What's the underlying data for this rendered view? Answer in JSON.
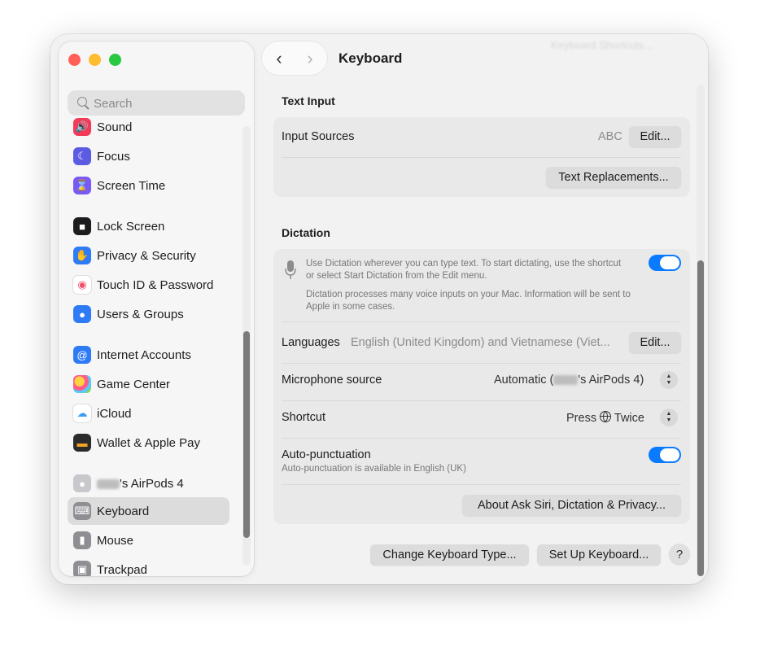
{
  "window": {
    "title": "Keyboard",
    "ghost_button": "Keyboard Shortcuts..."
  },
  "search": {
    "placeholder": "Search"
  },
  "sidebar": {
    "items": [
      {
        "label": "Sound",
        "icon": "speaker-icon",
        "color": "#f23b58"
      },
      {
        "label": "Focus",
        "icon": "moon-icon",
        "color": "#5b5ce2"
      },
      {
        "label": "Screen Time",
        "icon": "hourglass-icon",
        "color": "#7a5af5"
      },
      {
        "label": "Lock Screen",
        "icon": "lock-icon",
        "color": "#1c1c1e"
      },
      {
        "label": "Privacy & Security",
        "icon": "hand-icon",
        "color": "#2f7bf6"
      },
      {
        "label": "Touch ID & Password",
        "icon": "fingerprint-icon",
        "color": "#ffffff"
      },
      {
        "label": "Users & Groups",
        "icon": "users-icon",
        "color": "#2f7bf6"
      },
      {
        "label": "Internet Accounts",
        "icon": "at-icon",
        "color": "#2f7bf6"
      },
      {
        "label": "Game Center",
        "icon": "game-center-icon",
        "color": "#ffffff"
      },
      {
        "label": "iCloud",
        "icon": "cloud-icon",
        "color": "#ffffff"
      },
      {
        "label": "Wallet & Apple Pay",
        "icon": "wallet-icon",
        "color": "#2b2b2b"
      },
      {
        "label": "'s AirPods 4",
        "icon": "airpods-icon",
        "color": "#8e8e93"
      },
      {
        "label": "Keyboard",
        "icon": "keyboard-icon",
        "color": "#8e8e93"
      },
      {
        "label": "Mouse",
        "icon": "mouse-icon",
        "color": "#8e8e93"
      },
      {
        "label": "Trackpad",
        "icon": "trackpad-icon",
        "color": "#8e8e93"
      }
    ],
    "selected": "Keyboard"
  },
  "text_input": {
    "heading": "Text Input",
    "input_sources_label": "Input Sources",
    "input_sources_value": "ABC",
    "edit_label": "Edit...",
    "text_replacements_label": "Text Replacements..."
  },
  "dictation": {
    "heading": "Dictation",
    "description_1": "Use Dictation wherever you can type text. To start dictating, use the shortcut or select Start Dictation from the Edit menu.",
    "description_2": "Dictation processes many voice inputs on your Mac. Information will be sent to Apple in some cases.",
    "enabled": true,
    "languages_label": "Languages",
    "languages_value": "English (United Kingdom) and Vietnamese (Viet...",
    "languages_edit": "Edit...",
    "microphone_label": "Microphone source",
    "microphone_prefix": "Automatic (",
    "microphone_suffix": "'s AirPods 4)",
    "shortcut_label": "Shortcut",
    "shortcut_press": "Press",
    "shortcut_twice": "Twice",
    "autopunct_label": "Auto-punctuation",
    "autopunct_sub": "Auto-punctuation is available in English (UK)",
    "autopunct_enabled": true,
    "about_label": "About Ask Siri, Dictation & Privacy..."
  },
  "footer": {
    "change_type": "Change Keyboard Type...",
    "set_up": "Set Up Keyboard...",
    "help": "?"
  },
  "colors": {
    "accent": "#0a7aff",
    "selection": "#dcdcdc"
  }
}
